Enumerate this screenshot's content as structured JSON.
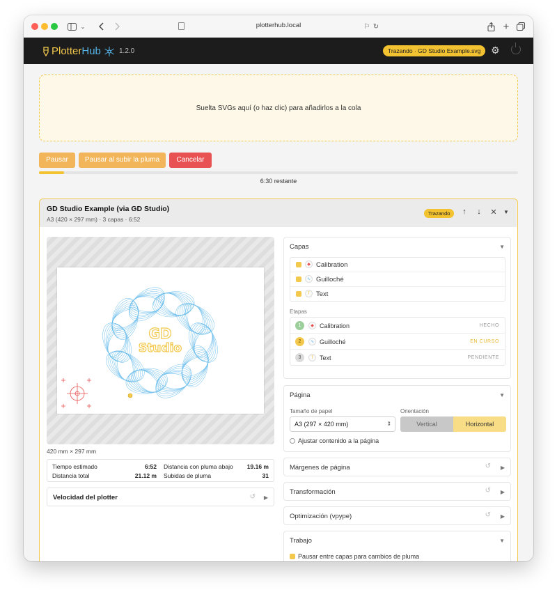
{
  "browser": {
    "url": "plotterhub.local"
  },
  "header": {
    "brand_part1": "Plotter",
    "brand_part2": "Hub",
    "version": "1.2.0",
    "job_pill": "Trazando · GD Studio Example.svg"
  },
  "dropzone": {
    "text": "Suelta SVGs aquí (o haz clic) para añadirlos a la cola"
  },
  "controls": {
    "pause": "Pausar",
    "pause_on_lift": "Pausar al subir la pluma",
    "cancel": "Cancelar",
    "progress_fraction": 0.053,
    "remaining": "6:30 restante"
  },
  "job": {
    "title": "GD Studio Example (via GD Studio)",
    "subtitle": "A3 (420 × 297 mm) · 3 capas · 6:52",
    "status": "Trazando",
    "preview_logo_line1": "GD",
    "preview_logo_line2": "Studio",
    "dims": "420 mm × 297 mm",
    "stats": [
      {
        "label": "Tiempo estimado",
        "value": "6:52"
      },
      {
        "label": "Distancia con pluma abajo",
        "value": "19.16 m"
      },
      {
        "label": "Distancia total",
        "value": "21.12 m"
      },
      {
        "label": "Subidas de pluma",
        "value": "31"
      }
    ],
    "speed_label": "Velocidad del plotter"
  },
  "layers_panel": {
    "title": "Capas",
    "layers": [
      {
        "name": "Calibration",
        "color": "#e85252"
      },
      {
        "name": "Guilloché",
        "color": "#56b4e9"
      },
      {
        "name": "Text",
        "color": "#f2c94c"
      }
    ],
    "stages_label": "Etapas",
    "stages": [
      {
        "num": "1",
        "name": "Calibration",
        "status": "HECHO",
        "num_color": "#9ccf9c",
        "status_color": "#999999"
      },
      {
        "num": "2",
        "name": "Guilloché",
        "status": "EN CURSO",
        "num_color": "#f2c94c",
        "status_color": "#e8b830"
      },
      {
        "num": "3",
        "name": "Text",
        "status": "PENDIENTE",
        "num_color": "#cccccc",
        "status_color": "#999999"
      }
    ]
  },
  "page_panel": {
    "title": "Página",
    "paper_label": "Tamaño de papel",
    "paper_value": "A3 (297 × 420 mm)",
    "orientation_label": "Orientación",
    "vertical": "Vertical",
    "horizontal": "Horizontal",
    "fit_label": "Ajustar contenido a la página"
  },
  "collapsed_panels": {
    "margins": "Márgenes de página",
    "transform": "Transformación",
    "optimize": "Optimización (vpype)"
  },
  "work_panel": {
    "title": "Trabajo",
    "pause_between_layers": "Pausar entre capas para cambios de pluma"
  },
  "colors": {
    "accent": "#f2c230",
    "danger": "#e85252",
    "guilloche": "#56b4e9",
    "calibration": "#e85252"
  }
}
